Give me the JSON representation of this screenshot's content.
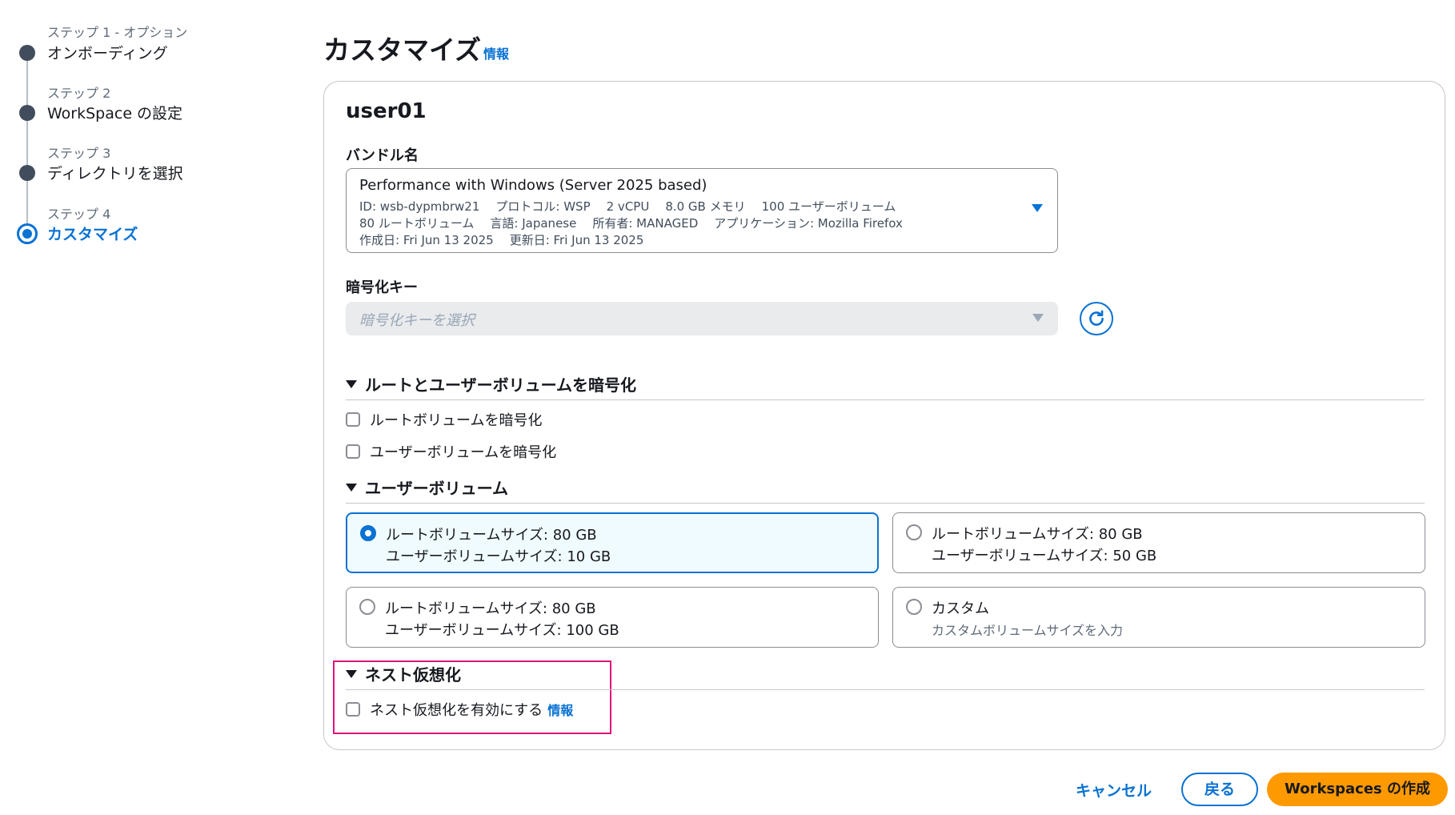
{
  "steps": [
    {
      "num": "ステップ 1 - オプション",
      "title": "オンボーディング"
    },
    {
      "num": "ステップ 2",
      "title": "WorkSpace の設定"
    },
    {
      "num": "ステップ 3",
      "title": "ディレクトリを選択"
    },
    {
      "num": "ステップ 4",
      "title": "カスタマイズ"
    }
  ],
  "header": {
    "title": "カスタマイズ",
    "info": "情報"
  },
  "main": {
    "user": "user01",
    "bundle": {
      "label": "バンドル名",
      "name": "Performance with Windows (Server 2025 based)",
      "meta1": [
        "ID: wsb-dypmbrw21",
        "プロトコル: WSP",
        "2 vCPU",
        "8.0 GB メモリ",
        "100 ユーザーボリューム"
      ],
      "meta2": [
        "80 ルートボリューム",
        "言語: Japanese",
        "所有者: MANAGED",
        "アプリケーション: Mozilla Firefox"
      ],
      "meta3": [
        "作成日: Fri Jun 13 2025",
        "更新日: Fri Jun 13 2025"
      ]
    },
    "encryption_key": {
      "label": "暗号化キー",
      "placeholder": "暗号化キーを選択"
    },
    "encrypt_section": {
      "title": "ルートとユーザーボリュームを暗号化",
      "root": "ルートボリュームを暗号化",
      "user": "ユーザーボリュームを暗号化"
    },
    "user_volume": {
      "title": "ユーザーボリューム",
      "options": [
        {
          "line1": "ルートボリュームサイズ: 80 GB",
          "line2": "ユーザーボリュームサイズ: 10 GB",
          "selected": true
        },
        {
          "line1": "ルートボリュームサイズ: 80 GB",
          "line2": "ユーザーボリュームサイズ: 50 GB",
          "selected": false
        },
        {
          "line1": "ルートボリュームサイズ: 80 GB",
          "line2": "ユーザーボリュームサイズ: 100 GB",
          "selected": false
        },
        {
          "line1": "カスタム",
          "line2": "カスタムボリュームサイズを入力",
          "selected": false
        }
      ]
    },
    "nested": {
      "title": "ネスト仮想化",
      "checkbox": "ネスト仮想化を有効にする",
      "info": "情報"
    }
  },
  "footer": {
    "cancel": "キャンセル",
    "back": "戻る",
    "create": "Workspaces の作成"
  },
  "colors": {
    "accent": "#0972d3",
    "primary_button": "#ff9900",
    "highlight": "#e0137c"
  },
  "icons": {
    "refresh": "refresh-icon",
    "caret": "caret-down-icon"
  }
}
